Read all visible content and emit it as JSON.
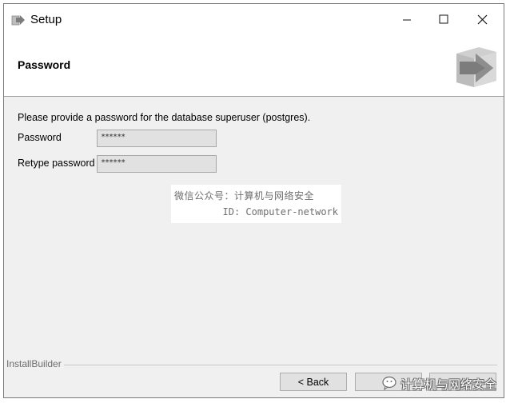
{
  "window": {
    "title": "Setup",
    "icon": "installer-app-icon",
    "controls": [
      "minimize-icon",
      "maximize-icon",
      "close-icon"
    ]
  },
  "header": {
    "title": "Password",
    "logo": "installbuilder-arrow-logo"
  },
  "content": {
    "prompt": "Please provide a password for the database superuser (postgres).",
    "fields": [
      {
        "label": "Password",
        "value": "******"
      },
      {
        "label": "Retype password",
        "value": "******"
      }
    ]
  },
  "watermark": {
    "line1": "微信公众号：计算机与网络安全",
    "line2": "ID: Computer-network"
  },
  "footer": {
    "brand": "InstallBuilder",
    "back_label": "< Back",
    "wechat_badge_text": "计算机与网络安全"
  },
  "colors": {
    "window_bg": "#f0f0f0",
    "header_bg": "#ffffff",
    "input_bg": "#e1e1e1",
    "button_bg": "#e1e1e1",
    "logo_arrow": "#7c7c7c",
    "logo_box": "#c9c9c9"
  }
}
